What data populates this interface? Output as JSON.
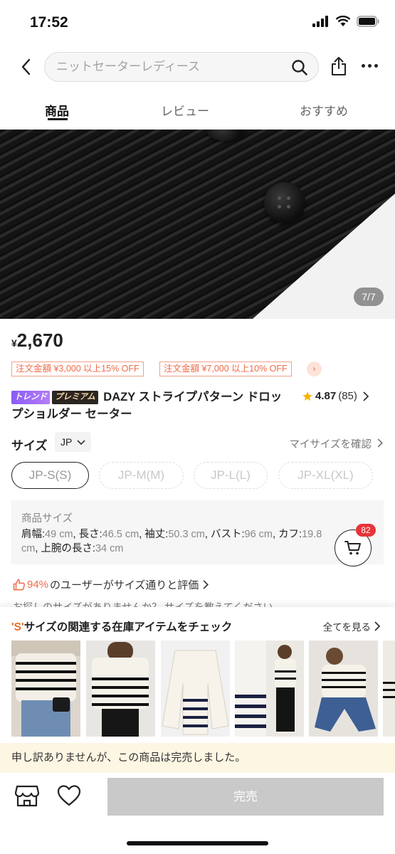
{
  "status_bar": {
    "time": "17:52"
  },
  "search": {
    "placeholder": "ニットセーターレディース"
  },
  "tabs": [
    {
      "label": "商品",
      "active": true
    },
    {
      "label": "レビュー",
      "active": false
    },
    {
      "label": "おすすめ",
      "active": false
    }
  ],
  "gallery": {
    "counter": "7/7",
    "current": 7,
    "total": 7
  },
  "product": {
    "price_symbol": "¥",
    "price": "2,670",
    "coupons": [
      "注文金額 ¥3,000 以上15% OFF",
      "注文金額 ¥7,000 以上10% OFF"
    ],
    "badges": {
      "trend": "トレンド",
      "premium": "プレミアム"
    },
    "title": "DAZY ストライプパターン ドロップショルダー セーター",
    "rating": "4.87",
    "review_count": "(85)"
  },
  "size": {
    "label": "サイズ",
    "unit": "JP",
    "my_size_link": "マイサイズを確認",
    "options": [
      {
        "label": "JP-S(S)",
        "state": "selected"
      },
      {
        "label": "JP-M(M)",
        "state": "disabled"
      },
      {
        "label": "JP-L(L)",
        "state": "disabled"
      },
      {
        "label": "JP-XL(XL)",
        "state": "disabled"
      }
    ]
  },
  "measurements": {
    "title": "商品サイズ",
    "items": [
      {
        "k": "肩幅:",
        "v": "49 cm"
      },
      {
        "k": "長さ:",
        "v": "46.5 cm"
      },
      {
        "k": "袖丈:",
        "v": "50.3 cm"
      },
      {
        "k": "バスト:",
        "v": "96 cm"
      },
      {
        "k": "カフ:",
        "v": "19.8 cm"
      },
      {
        "k": "上腕の長さ:",
        "v": "34 cm"
      }
    ]
  },
  "cart": {
    "count": "82"
  },
  "fit": {
    "percent": "94%",
    "text": "のユーザーがサイズ通りと評価"
  },
  "cut_text": "お探しのサイズがありませんか？ サイズを教えてください",
  "related": {
    "highlight": "'S'",
    "title_rest": "サイズの関連する在庫アイテムをチェック",
    "see_all": "全てを見る"
  },
  "soldout": {
    "message": "申し訳ありませんが、この商品は完売しました。",
    "button": "完売"
  },
  "colors": {
    "coupon": "#f06a48",
    "badge": "#e8343a",
    "sold_bar": "#fdf6e3",
    "disabled_btn": "#c9c9c9"
  }
}
